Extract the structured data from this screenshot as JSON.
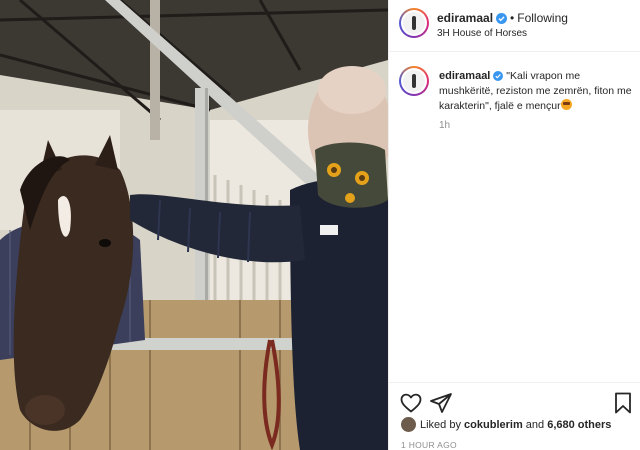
{
  "header": {
    "username": "ediramaal",
    "separator": "•",
    "follow_state": "Following",
    "location": "3H House of Horses"
  },
  "caption": {
    "username": "ediramaal",
    "text": "\"Kali vrapon me mushkëritë, reziston me zemrën, fiton me karakterin\", fjalë e mençur",
    "emoji": "face-with-sunglasses-emoji",
    "time": "1h"
  },
  "actions": {
    "like_icon": "heart-icon",
    "share_icon": "paper-plane-icon",
    "save_icon": "bookmark-icon"
  },
  "likes": {
    "prefix": "Liked by",
    "user": "cokublerim",
    "connector": "and",
    "others": "6,680 others"
  },
  "date": "1 HOUR AGO",
  "colors": {
    "verified_badge": "#3897f0",
    "muted_text": "#8e8e8e",
    "divider": "#efefef"
  }
}
